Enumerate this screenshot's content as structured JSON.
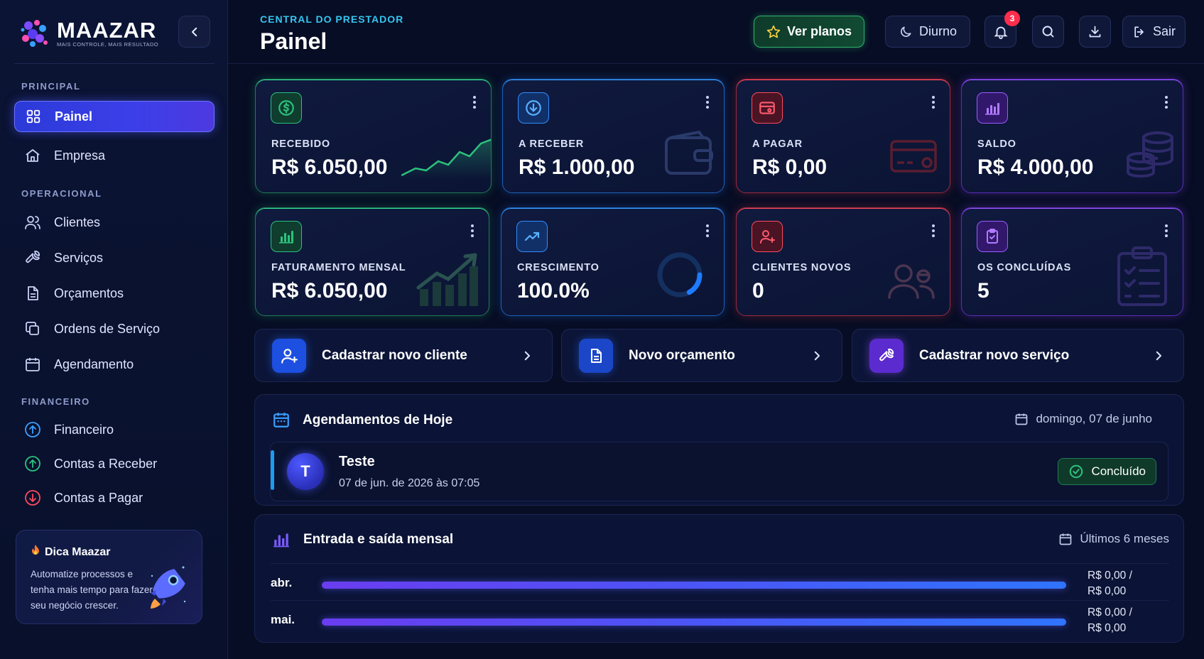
{
  "brand": {
    "name": "MAAZAR",
    "tagline": "MAIS CONTROLE, MAIS RESULTADO"
  },
  "sidebar": {
    "sections": {
      "principal": "PRINCIPAL",
      "operacional": "OPERACIONAL",
      "financeiro": "FINANCEIRO"
    },
    "items": [
      {
        "label": "Painel",
        "icon": "grid-icon",
        "active": true
      },
      {
        "label": "Empresa",
        "icon": "home-icon"
      },
      {
        "label": "Clientes",
        "icon": "users-icon"
      },
      {
        "label": "Serviços",
        "icon": "wrench-icon"
      },
      {
        "label": "Orçamentos",
        "icon": "document-icon"
      },
      {
        "label": "Ordens de Serviço",
        "icon": "copy-icon"
      },
      {
        "label": "Agendamento",
        "icon": "calendar-icon"
      },
      {
        "label": "Financeiro",
        "icon": "arrow-up-circle-icon"
      },
      {
        "label": "Contas a Receber",
        "icon": "arrow-up-circle-green-icon"
      },
      {
        "label": "Contas a Pagar",
        "icon": "arrow-down-circle-red-icon"
      }
    ],
    "tip": {
      "title": "Dica Maazar",
      "text": "Automatize processos e tenha mais tempo para fazer seu negócio crescer."
    }
  },
  "header": {
    "subtitle": "CENTRAL DO PRESTADOR",
    "title": "Painel",
    "plans_label": "Ver planos",
    "theme_label": "Diurno",
    "notifications_count": "3",
    "logout_label": "Sair"
  },
  "stats": [
    {
      "label": "RECEBIDO",
      "value": "R$ 6.050,00",
      "color": "#2cc27d"
    },
    {
      "label": "A RECEBER",
      "value": "R$ 1.000,00",
      "color": "#2f8cff"
    },
    {
      "label": "A PAGAR",
      "value": "R$ 0,00",
      "color": "#ff4a5f"
    },
    {
      "label": "SALDO",
      "value": "R$ 4.000,00",
      "color": "#9a5bff"
    },
    {
      "label": "FATURAMENTO MENSAL",
      "value": "R$ 6.050,00",
      "color": "#2cc27d"
    },
    {
      "label": "CRESCIMENTO",
      "value": "100.0%",
      "color": "#2f8cff"
    },
    {
      "label": "CLIENTES NOVOS",
      "value": "0",
      "color": "#ff4a5f"
    },
    {
      "label": "OS CONCLUÍDAS",
      "value": "5",
      "color": "#9a5bff"
    }
  ],
  "actions": [
    {
      "label": "Cadastrar novo cliente"
    },
    {
      "label": "Novo orçamento"
    },
    {
      "label": "Cadastrar novo serviço"
    }
  ],
  "schedule": {
    "title": "Agendamentos de Hoje",
    "date": "domingo, 07 de junho",
    "items": [
      {
        "initial": "T",
        "name": "Teste",
        "datetime": "07 de jun. de 2026 às 07:05",
        "status": "Concluído"
      }
    ]
  },
  "cashflow": {
    "title": "Entrada e saída mensal",
    "period": "Últimos 6 meses",
    "rows": [
      {
        "month": "abr.",
        "income": "R$ 0,00 /",
        "expense": "R$ 0,00"
      },
      {
        "month": "mai.",
        "income": "R$ 0,00 /",
        "expense": "R$ 0,00"
      }
    ]
  }
}
